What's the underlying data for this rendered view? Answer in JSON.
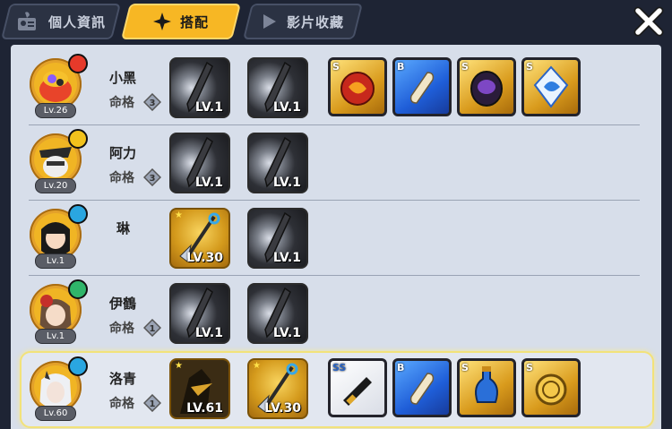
{
  "tabs": [
    {
      "label": "個人資訊",
      "active": false,
      "icon": "profile-card-icon"
    },
    {
      "label": "搭配",
      "active": true,
      "icon": "four-point-star-icon"
    },
    {
      "label": "影片收藏",
      "active": false,
      "icon": "play-icon"
    }
  ],
  "close_icon": "close-x-icon",
  "fate_label": "命格",
  "characters": [
    {
      "name": "小黑",
      "level": "Lv.26",
      "fate_rank": "3",
      "element": "fire",
      "weapons": [
        {
          "level": "LV.1",
          "type": "dark-blade",
          "star": false
        },
        {
          "level": "LV.1",
          "type": "dark-blade",
          "star": false
        }
      ],
      "items": [
        {
          "grade": "S",
          "rarity": "gold",
          "icon": "red-rune-icon"
        },
        {
          "grade": "B",
          "rarity": "blue",
          "icon": "scroll-icon"
        },
        {
          "grade": "S",
          "rarity": "gold",
          "icon": "purple-daruma-icon"
        },
        {
          "grade": "S",
          "rarity": "gold",
          "icon": "ice-crystal-icon"
        }
      ]
    },
    {
      "name": "阿力",
      "level": "Lv.20",
      "fate_rank": "3",
      "element": "lightning",
      "weapons": [
        {
          "level": "LV.1",
          "type": "dark-blade",
          "star": false
        },
        {
          "level": "LV.1",
          "type": "dark-blade",
          "star": false
        }
      ],
      "items": []
    },
    {
      "name": "琳",
      "level": "Lv.1",
      "fate_rank": "",
      "element": "water",
      "weapons": [
        {
          "level": "LV.30",
          "type": "spear",
          "star": true
        },
        {
          "level": "LV.1",
          "type": "dark-blade",
          "star": false
        }
      ],
      "items": []
    },
    {
      "name": "伊鶴",
      "level": "Lv.1",
      "fate_rank": "1",
      "element": "wind",
      "weapons": [
        {
          "level": "LV.1",
          "type": "dark-blade",
          "star": false
        },
        {
          "level": "LV.1",
          "type": "dark-blade",
          "star": false
        }
      ],
      "items": []
    },
    {
      "name": "洛青",
      "level": "Lv.60",
      "fate_rank": "1",
      "element": "water",
      "weapons": [
        {
          "level": "LV.61",
          "type": "shadow-warrior",
          "star": true
        },
        {
          "level": "LV.30",
          "type": "spear",
          "star": true
        }
      ],
      "items": [
        {
          "grade": "SS",
          "rarity": "white",
          "icon": "black-scroll-tube-icon"
        },
        {
          "grade": "B",
          "rarity": "blue",
          "icon": "scroll-icon"
        },
        {
          "grade": "S",
          "rarity": "gold",
          "icon": "potion-bottle-icon"
        },
        {
          "grade": "S",
          "rarity": "gold",
          "icon": "gold-coin-icon"
        }
      ]
    }
  ],
  "colors": {
    "accent": "#f7b724",
    "panel": "#d7deea",
    "bar": "#1e2434",
    "selected_border": "#f2e27a"
  }
}
